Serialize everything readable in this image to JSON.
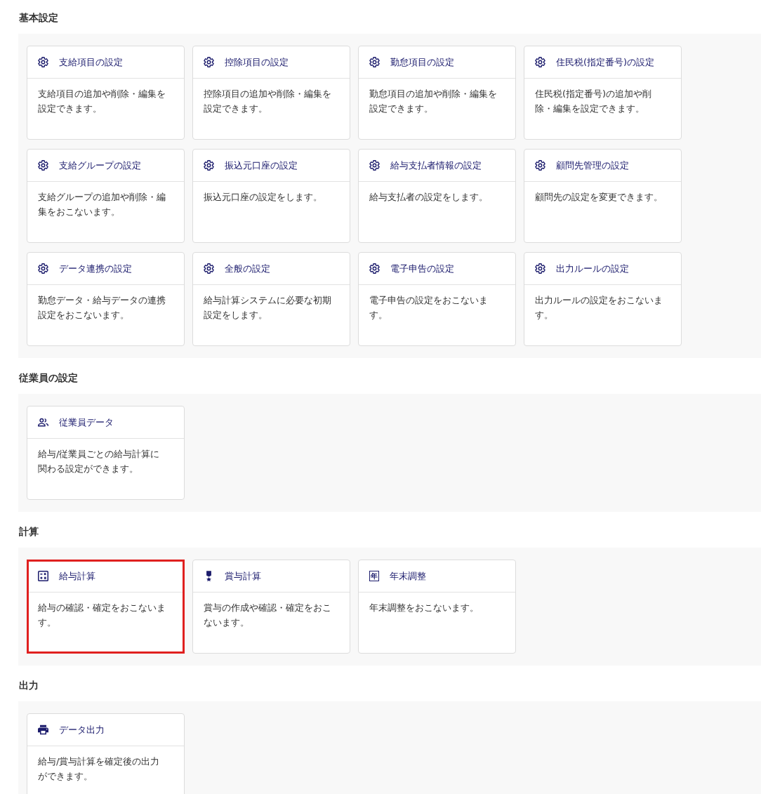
{
  "sections": [
    {
      "title": "基本設定",
      "cards": [
        {
          "kind": "settings",
          "title": "支給項目の設定",
          "description": "支給項目の追加や削除・編集を設定できます。",
          "highlighted": false
        },
        {
          "kind": "settings",
          "title": "控除項目の設定",
          "description": "控除項目の追加や削除・編集を設定できます。",
          "highlighted": false
        },
        {
          "kind": "settings",
          "title": "勤怠項目の設定",
          "description": "勤怠項目の追加や削除・編集を設定できます。",
          "highlighted": false
        },
        {
          "kind": "settings",
          "title": "住民税(指定番号)の設定",
          "description": "住民税(指定番号)の追加や削除・編集を設定できます。",
          "highlighted": false
        },
        {
          "kind": "settings",
          "title": "支給グループの設定",
          "description": "支給グループの追加や削除・編集をおこないます。",
          "highlighted": false
        },
        {
          "kind": "settings",
          "title": "振込元口座の設定",
          "description": "振込元口座の設定をします。",
          "highlighted": false
        },
        {
          "kind": "settings",
          "title": "給与支払者情報の設定",
          "description": "給与支払者の設定をします。",
          "highlighted": false
        },
        {
          "kind": "settings",
          "title": "顧問先管理の設定",
          "description": "顧問先の設定を変更できます。",
          "highlighted": false
        },
        {
          "kind": "settings",
          "title": "データ連携の設定",
          "description": "勤怠データ・給与データの連携設定をおこないます。",
          "highlighted": false
        },
        {
          "kind": "settings",
          "title": "全般の設定",
          "description": "給与計算システムに必要な初期設定をします。",
          "highlighted": false
        },
        {
          "kind": "settings",
          "title": "電子申告の設定",
          "description": "電子申告の設定をおこないます。",
          "highlighted": false
        },
        {
          "kind": "settings",
          "title": "出力ルールの設定",
          "description": "出力ルールの設定をおこないます。",
          "highlighted": false
        }
      ]
    },
    {
      "title": "従業員の設定",
      "cards": [
        {
          "kind": "people",
          "title": "従業員データ",
          "description": "給与/従業員ごとの給与計算に関わる設定ができます。",
          "highlighted": false
        }
      ]
    },
    {
      "title": "計算",
      "cards": [
        {
          "kind": "calculator",
          "title": "給与計算",
          "description": "給与の確認・確定をおこないます。",
          "highlighted": true
        },
        {
          "kind": "medal",
          "title": "賞与計算",
          "description": "賞与の作成や確認・確定をおこないます。",
          "highlighted": false
        },
        {
          "kind": "glyph",
          "icon_text": "年",
          "title": "年末調整",
          "description": "年末調整をおこないます。",
          "highlighted": false
        }
      ]
    },
    {
      "title": "出力",
      "cards": [
        {
          "kind": "printer",
          "title": "データ出力",
          "description": "給与/賞与計算を確定後の出力ができます。",
          "highlighted": false
        }
      ]
    }
  ]
}
